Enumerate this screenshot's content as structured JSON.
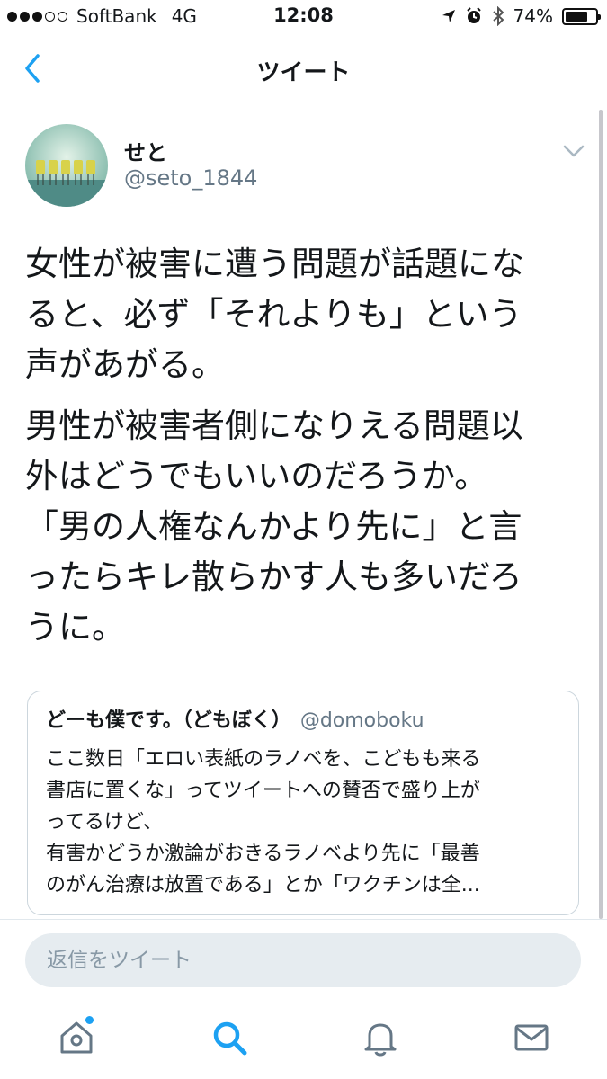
{
  "status_bar": {
    "carrier": "SoftBank",
    "network": "4G",
    "time": "12:08",
    "battery_percent": "74%",
    "battery_level": 0.74
  },
  "nav": {
    "title": "ツイート",
    "back_icon": "chevron-left-icon"
  },
  "tweet": {
    "author_name": "せと",
    "author_handle": "@seto_1844",
    "paragraphs": [
      "女性が被害に遭う問題が話題にな\nると、必ず「それよりも」という\n声があがる。",
      "男性が被害者側になりえる問題以\n外はどうでもいいのだろうか。\n「男の人権なんかより先に」と言\nったらキレ散らかす人も多いだろ\nうに。"
    ]
  },
  "quoted_tweet": {
    "author_name": "どーも僕です。（どもぼく）",
    "author_handle": "@domoboku",
    "lines": [
      "ここ数日「エロい表紙のラノベを、こどもも来る",
      "書店に置くな」ってツイートへの賛否で盛り上が",
      "ってるけど、",
      "有害かどうか激論がおきるラノベより先に「最善",
      "のがん治療は放置である」とか「ワクチンは全..."
    ]
  },
  "reply": {
    "placeholder": "返信をツイート"
  },
  "tab_bar": {
    "items": [
      "home-icon",
      "search-icon",
      "notifications-bell-icon",
      "messages-envelope-icon"
    ],
    "active": "search-icon"
  },
  "colors": {
    "accent": "#1da1f2",
    "secondary_text": "#657786",
    "divider": "#e1e8ed"
  }
}
